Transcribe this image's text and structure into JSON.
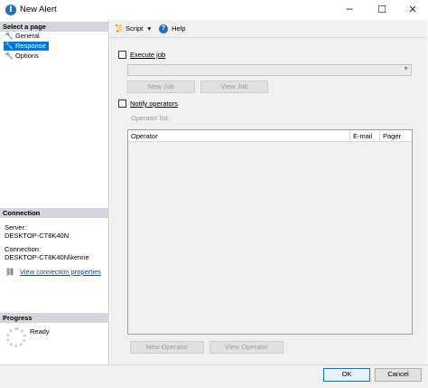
{
  "window": {
    "title": "New Alert",
    "minimize_glyph": "─",
    "maximize_glyph": "☐",
    "close_glyph": "✕",
    "app_icon": "info-icon",
    "app_icon_glyph": "i"
  },
  "left_pane": {
    "select_page_header": "Select a page",
    "pages": [
      {
        "label": "General",
        "selected": false,
        "icon": "wrench-icon"
      },
      {
        "label": "Response",
        "selected": true,
        "icon": "wrench-icon"
      },
      {
        "label": "Options",
        "selected": false,
        "icon": "wrench-icon"
      }
    ],
    "connection_header": "Connection",
    "server_label": "Server:",
    "server_value": "DESKTOP-CT8K40N",
    "connection_label": "Connection:",
    "connection_value": "DESKTOP-CT8K40N\\kenne",
    "view_connection_link": "View connection properties",
    "progress_header": "Progress",
    "progress_status": "Ready"
  },
  "toolbar": {
    "script_label": "Script",
    "help_label": "Help",
    "help_glyph": "?"
  },
  "response": {
    "execute_job_label": "Execute job",
    "execute_job_checked": false,
    "job_combo_value": "",
    "new_job_button": "New Job",
    "view_job_button": "View Job",
    "notify_operators_label": "Notify operators",
    "notify_operators_checked": false,
    "operator_list_label": "Operator list:",
    "operator_columns": [
      "Operator",
      "E-mail",
      "Pager"
    ],
    "operator_rows": [],
    "new_operator_button": "New Operator",
    "view_operator_button": "View Operator"
  },
  "footer": {
    "ok_button": "OK",
    "cancel_button": "Cancel"
  },
  "colors": {
    "selection_blue": "#0078d7",
    "header_grey": "#d4d6db",
    "pane_background": "#f0f0f0",
    "link_blue": "#0645c8"
  }
}
